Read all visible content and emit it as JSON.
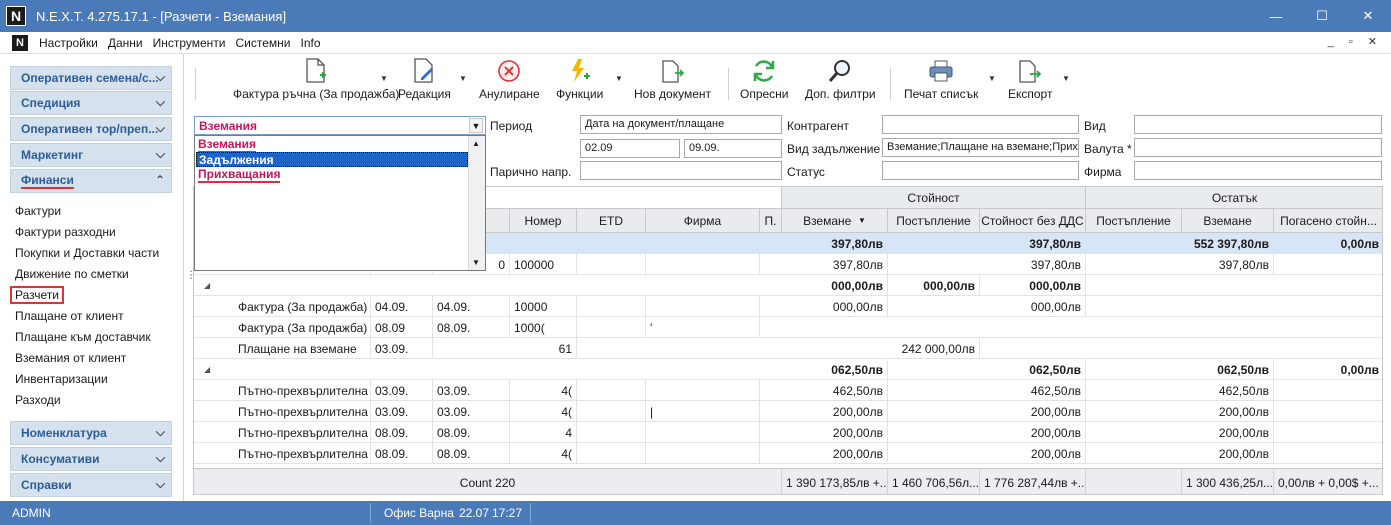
{
  "window": {
    "logo": "N",
    "title": "N.E.X.T. 4.275.17.1 - [Разчети - Вземания]",
    "minimize": "—",
    "maximize": "☐",
    "close": "✕"
  },
  "menubar": {
    "logo": "N",
    "items": [
      "Настройки",
      "Данни",
      "Инструменти",
      "Системни",
      "Info"
    ],
    "mdi_controls": "_ ▫ ✕"
  },
  "sidebar": {
    "groups_top": [
      {
        "label": "Оперативен семена/с..."
      },
      {
        "label": "Спедиция"
      },
      {
        "label": "Оперативен тор/преп..."
      },
      {
        "label": "Маркетинг"
      },
      {
        "label": "Финанси"
      }
    ],
    "links": [
      "Фактури",
      "Фактури разходни",
      "Покупки и Доставки части",
      "Движение по сметки",
      "Разчети",
      "Плащане от клиент",
      "Плащане към доставчик",
      "Вземания от клиент",
      "Инвентаризации",
      "Разходи"
    ],
    "groups_bottom": [
      {
        "label": "Номенклатура"
      },
      {
        "label": "Консумативи"
      },
      {
        "label": "Справки"
      }
    ]
  },
  "toolbar": {
    "buttons": [
      {
        "label": "Фактура ръчна (За продажба)",
        "icon": "new-invoice-icon"
      },
      {
        "label": "Редакция",
        "icon": "edit-icon"
      },
      {
        "label": "Анулиране",
        "icon": "cancel-icon"
      },
      {
        "label": "Функции",
        "icon": "functions-icon"
      },
      {
        "label": "Нов документ",
        "icon": "new-document-icon"
      },
      {
        "label": "Опресни",
        "icon": "refresh-icon"
      },
      {
        "label": "Доп. филтри",
        "icon": "search-icon"
      },
      {
        "label": "Печат списък",
        "icon": "print-icon"
      },
      {
        "label": "Експорт",
        "icon": "export-icon"
      }
    ]
  },
  "filters": {
    "type_combo": {
      "value": "Вземания",
      "options": [
        "Вземания",
        "Задължения",
        "Прихващания"
      ],
      "selected": "Задължения"
    },
    "period_label": "Период",
    "period_type": "Дата на документ/плащане",
    "date_from": "02.09",
    "date_to": "09.09.",
    "cash_label": "Парично напр.",
    "cash_value": "",
    "contractor_label": "Контрагент",
    "contractor_value": "",
    "obligation_label": "Вид задължение",
    "obligation_value": "Вземание;Плащане на вземане;Прих",
    "status_label": "Статус",
    "status_value": "",
    "kind_label": "Вид",
    "kind_value": "",
    "currency_label": "Валута *",
    "currency_value": "",
    "firm_label": "Фирма",
    "firm_value": ""
  },
  "grid": {
    "band_value": "Стойност",
    "band_remain": "Остатък",
    "columns": [
      "Номер",
      "ETD",
      "Фирма",
      "П.",
      "Вземане",
      "Постъпление",
      "Стойност без ДДС",
      "Постъпление",
      "Вземане",
      "Погасено стойн..."
    ],
    "rows": [
      {
        "type": "group",
        "first": true,
        "c_vzemane": "397,80лв",
        "c_bezdds": "397,80лв",
        "c_r_vzemane": "552 397,80лв",
        "c_pogaseno": "0,00лв"
      },
      {
        "type": "data",
        "doc": "",
        "d1": "",
        "d2": "0",
        "num": "100000",
        "c_vzemane": "397,80лв",
        "c_bezdds": "397,80лв",
        "c_r_vzemane": "397,80лв"
      },
      {
        "type": "group",
        "c_vzemane": "000,00лв",
        "c_post": "000,00лв",
        "c_bezdds": "000,00лв"
      },
      {
        "type": "data",
        "doc": "Фактура (За продажба)",
        "d1": "04.09.",
        "d2": "04.09.",
        "num": "10000",
        "c_vzemane": "000,00лв",
        "c_bezdds": "000,00лв"
      },
      {
        "type": "data",
        "doc": "Фактура (За продажба)",
        "d1": "08.09",
        "d2": "08.09.",
        "num": "1000(",
        "firm": "'"
      },
      {
        "type": "data",
        "doc": "Плащане на вземане",
        "d1": "03.09.",
        "num": "61",
        "c_post": "242 000,00лв"
      },
      {
        "type": "group",
        "c_vzemane": "062,50лв",
        "c_bezdds": "062,50лв",
        "c_r_vzemane": "062,50лв",
        "c_pogaseno": "0,00лв"
      },
      {
        "type": "data",
        "doc": "Пътно-прехвърлителна",
        "d1": "03.09.",
        "d2": "03.09.",
        "num": "4(",
        "c_vzemane": "462,50лв",
        "c_bezdds": "462,50лв",
        "c_r_vzemane": "462,50лв"
      },
      {
        "type": "data",
        "doc": "Пътно-прехвърлителна",
        "d1": "03.09.",
        "d2": "03.09.",
        "num": "4(",
        "firm": "|",
        "c_vzemane": "200,00лв",
        "c_bezdds": "200,00лв",
        "c_r_vzemane": "200,00лв"
      },
      {
        "type": "data",
        "doc": "Пътно-прехвърлителна",
        "d1": "08.09.",
        "d2": "08.09.",
        "num": "4",
        "c_vzemane": "200,00лв",
        "c_bezdds": "200,00лв",
        "c_r_vzemane": "200,00лв"
      },
      {
        "type": "data",
        "doc": "Пътно-прехвърлителна",
        "d1": "08.09.",
        "d2": "08.09.",
        "num": "4(",
        "c_vzemane": "200,00лв",
        "c_bezdds": "200,00лв",
        "c_r_vzemane": "200,00лв"
      }
    ],
    "footer": {
      "count": "Count 220",
      "vzemane": "1 390 173,85лв +...",
      "post": "1 460 706,56л...",
      "bezdds": "1 776 287,44лв +...",
      "r_vzemane": "1 300 436,25л...",
      "pogaseno": "0,00лв + 0,00$ +..."
    }
  },
  "statusbar": {
    "user": "ADMIN",
    "office": "Офис Варна",
    "date": "22.07",
    "time": "17:27"
  },
  "colors": {
    "titlebar": "#4a7ab8",
    "accent_blue": "#2b5d97",
    "pink": "#c2185b",
    "selected": "#1e64c8"
  }
}
